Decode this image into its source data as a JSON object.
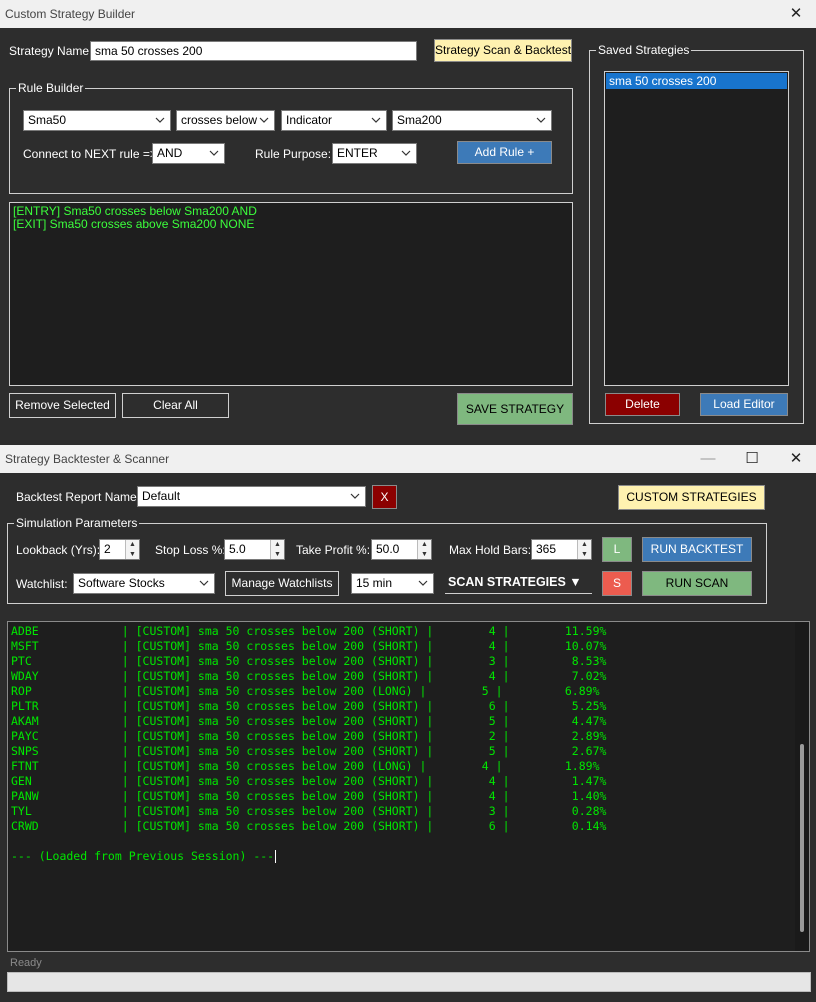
{
  "builder": {
    "title": "Custom Strategy Builder",
    "strategy_name_label": "Strategy Name:",
    "strategy_name_value": "sma 50 crosses 200",
    "scan_backtest_button": "Strategy Scan & Backtest",
    "rule_builder_legend": "Rule Builder",
    "left_indicator": "Sma50",
    "operator": "crosses below",
    "compare_type": "Indicator",
    "right_indicator": "Sma200",
    "connect_label": "Connect to NEXT rule =>",
    "connect_value": "AND",
    "purpose_label": "Rule Purpose:",
    "purpose_value": "ENTER",
    "add_rule_button": "Add Rule +",
    "rules": [
      "[ENTRY] Sma50 crosses below Sma200 AND",
      "[EXIT] Sma50 crosses above Sma200 NONE"
    ],
    "remove_selected_button": "Remove Selected",
    "clear_all_button": "Clear All",
    "save_strategy_button": "SAVE STRATEGY",
    "saved_legend": "Saved Strategies",
    "saved_items": [
      "sma 50 crosses 200"
    ],
    "delete_button": "Delete",
    "load_editor_button": "Load Editor"
  },
  "backtester": {
    "title": "Strategy Backtester & Scanner",
    "report_name_label": "Backtest Report Name:",
    "report_name_value": "Default",
    "x_button": "X",
    "custom_strategies_button": "CUSTOM STRATEGIES",
    "sim_legend": "Simulation Parameters",
    "lookback_label": "Lookback (Yrs):",
    "lookback_value": "2",
    "stop_loss_label": "Stop Loss %:",
    "stop_loss_value": "5.0",
    "take_profit_label": "Take Profit %:",
    "take_profit_value": "50.0",
    "max_hold_label": "Max Hold Bars:",
    "max_hold_value": "365",
    "l_button": "L",
    "run_backtest_button": "RUN BACKTEST",
    "watchlist_label": "Watchlist:",
    "watchlist_value": "Software Stocks",
    "manage_watchlists_button": "Manage Watchlists",
    "interval_value": "15 min",
    "scan_strategies_label": "SCAN STRATEGIES ▼",
    "s_button": "S",
    "run_scan_button": "RUN SCAN",
    "results": [
      "ADBE            | [CUSTOM] sma 50 crosses below 200 (SHORT) |        4 |        11.59%",
      "MSFT            | [CUSTOM] sma 50 crosses below 200 (SHORT) |        4 |        10.07%",
      "PTC             | [CUSTOM] sma 50 crosses below 200 (SHORT) |        3 |         8.53%",
      "WDAY            | [CUSTOM] sma 50 crosses below 200 (SHORT) |        4 |         7.02%",
      "ROP             | [CUSTOM] sma 50 crosses below 200 (LONG) |        5 |         6.89%",
      "PLTR            | [CUSTOM] sma 50 crosses below 200 (SHORT) |        6 |         5.25%",
      "AKAM            | [CUSTOM] sma 50 crosses below 200 (SHORT) |        5 |         4.47%",
      "PAYC            | [CUSTOM] sma 50 crosses below 200 (SHORT) |        2 |         2.89%",
      "SNPS            | [CUSTOM] sma 50 crosses below 200 (SHORT) |        5 |         2.67%",
      "FTNT            | [CUSTOM] sma 50 crosses below 200 (LONG) |        4 |         1.89%",
      "GEN             | [CUSTOM] sma 50 crosses below 200 (SHORT) |        4 |         1.47%",
      "PANW            | [CUSTOM] sma 50 crosses below 200 (SHORT) |        4 |         1.40%",
      "TYL             | [CUSTOM] sma 50 crosses below 200 (SHORT) |        3 |         0.28%",
      "CRWD            | [CUSTOM] sma 50 crosses below 200 (SHORT) |        6 |         0.14%"
    ],
    "session_note": "--- (Loaded from Previous Session) ---",
    "status": "Ready"
  },
  "colors": {
    "console_text": "#00e600",
    "accent_blue": "#3d7ab8",
    "accent_green": "#7fb87f",
    "danger_red": "#8b0000",
    "highlight_yellow": "#fff2b0"
  }
}
